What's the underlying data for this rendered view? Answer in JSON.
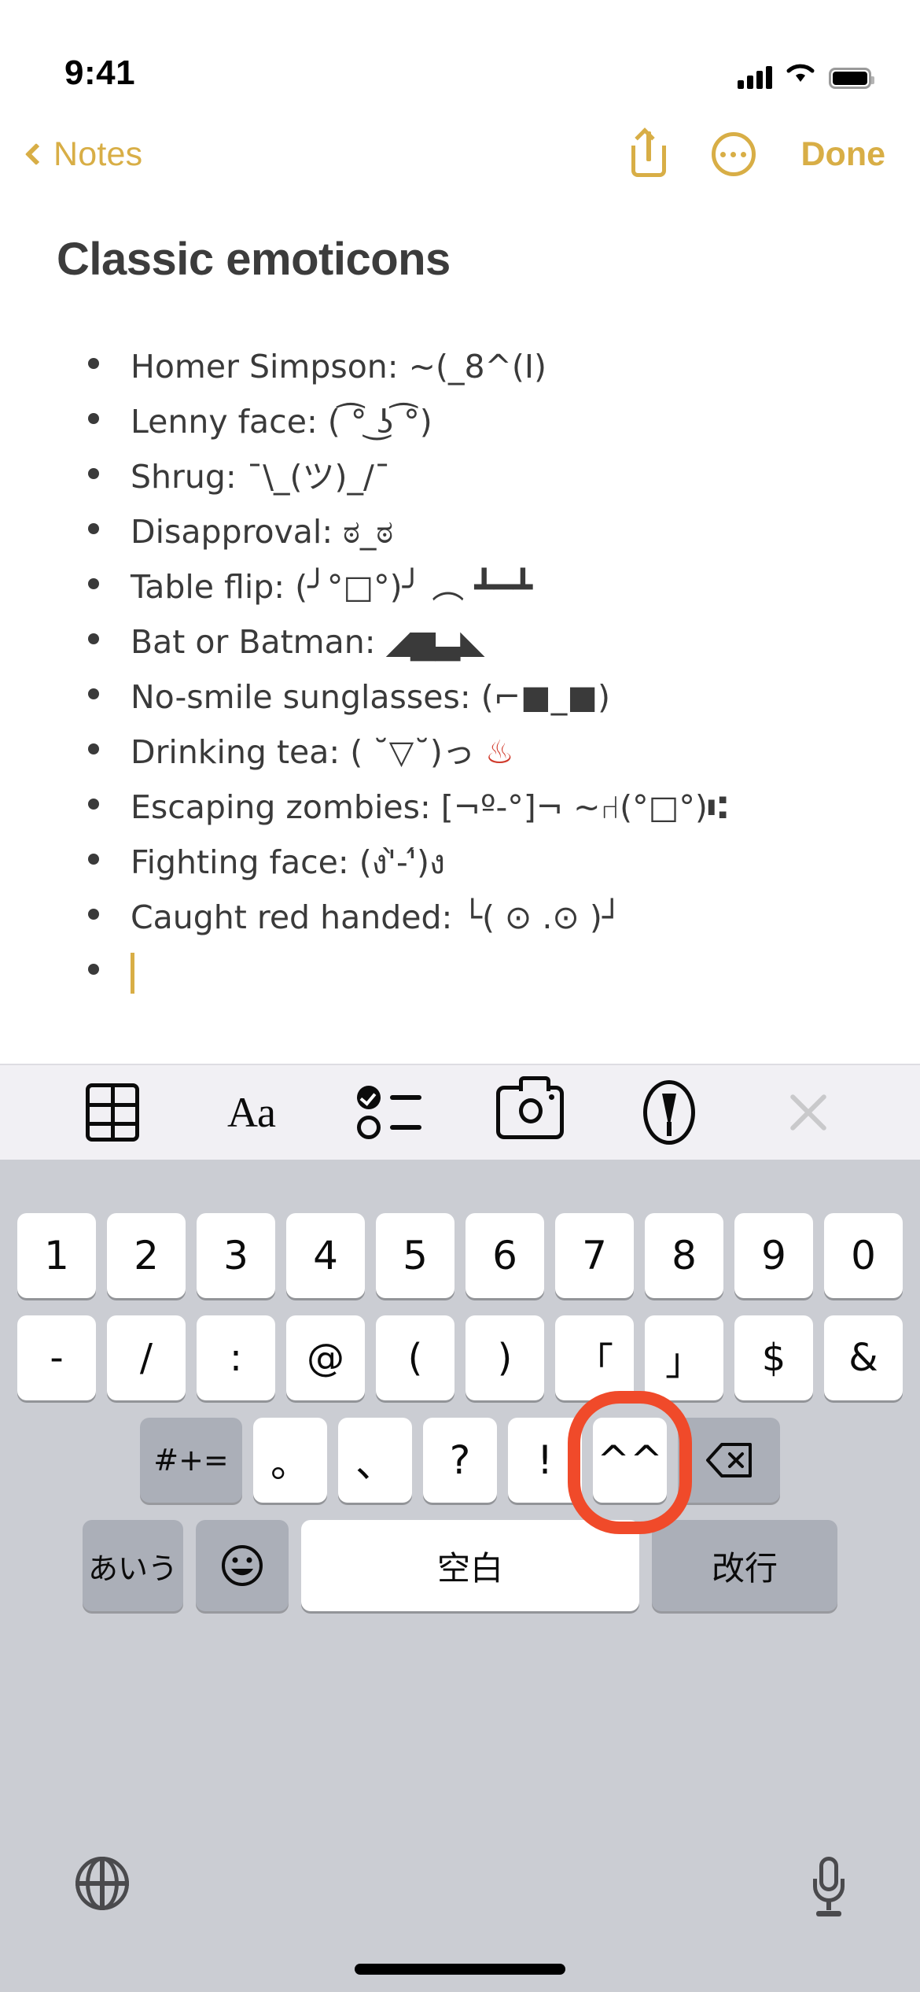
{
  "status_bar": {
    "time": "9:41",
    "signal_icon": "cellular-signal-icon",
    "wifi_icon": "wifi-icon",
    "battery_icon": "battery-icon"
  },
  "nav_bar": {
    "back_label": "Notes",
    "back_icon": "chevron-left-icon",
    "share_icon": "share-icon",
    "more_icon": "ellipsis-circle-icon",
    "done_label": "Done",
    "accent_color": "#D8AE46"
  },
  "note": {
    "title": "Classic emoticons",
    "text_color": "#3C3C3C",
    "cursor_color": "#D8AE46",
    "bullets": [
      {
        "label": "Homer Simpson:",
        "art": "~(_8^(I)"
      },
      {
        "label": "Lenny face:",
        "art": "( ͡° ͜ʖ ͡°)"
      },
      {
        "label": "Shrug:",
        "art": "¯\\_(ツ)_/¯"
      },
      {
        "label": "Disapproval:",
        "art": "ಠ_ಠ"
      },
      {
        "label": "Table flip:",
        "art": "(╯°□°)╯ ︵ ┻━┻"
      },
      {
        "label": "Bat or Batman:",
        "art": "◢▆▃◣"
      },
      {
        "label": "No-smile sunglasses:",
        "art": "(⌐■_■)"
      },
      {
        "label": "Drinking tea:",
        "art": "( ˘▽˘)っ",
        "emoji": "♨"
      },
      {
        "label": "Escaping zombies:",
        "art": "[¬º-°]¬ ~⑁(°□°)⑆"
      },
      {
        "label": "Fighting face:",
        "art": "(ง'̀-'́)ง"
      },
      {
        "label": "Caught red handed:",
        "art": "└( ⊙ .⊙ )┘"
      },
      {
        "label": "",
        "art": "",
        "empty": true
      }
    ]
  },
  "format_toolbar": {
    "background": "#F1F0F4",
    "items": [
      {
        "name": "table-icon",
        "label": ""
      },
      {
        "name": "text-format-icon",
        "label": "Aa"
      },
      {
        "name": "checklist-icon",
        "label": ""
      },
      {
        "name": "camera-icon",
        "label": ""
      },
      {
        "name": "markup-pen-icon",
        "label": ""
      },
      {
        "name": "close-icon",
        "label": ""
      }
    ]
  },
  "keyboard": {
    "background": "#CBCDD3",
    "highlight_color": "#F04A2A",
    "highlighted_key": "^^",
    "row1": [
      "1",
      "2",
      "3",
      "4",
      "5",
      "6",
      "7",
      "8",
      "9",
      "0"
    ],
    "row2": [
      "-",
      "/",
      ":",
      "@",
      "(",
      ")",
      "「",
      "」",
      "$",
      "&"
    ],
    "row3": {
      "shift_label": "#+=",
      "keys": [
        "。",
        "、",
        "?",
        "!",
        "^^"
      ],
      "backspace_icon": "backspace-icon"
    },
    "row4": {
      "alt_label": "あいう",
      "emoji_icon": "emoji-smiley-icon",
      "space_label": "空白",
      "return_label": "改行"
    },
    "bottom": {
      "globe_icon": "globe-icon",
      "mic_icon": "microphone-icon",
      "home_indicator": "home-indicator"
    }
  }
}
